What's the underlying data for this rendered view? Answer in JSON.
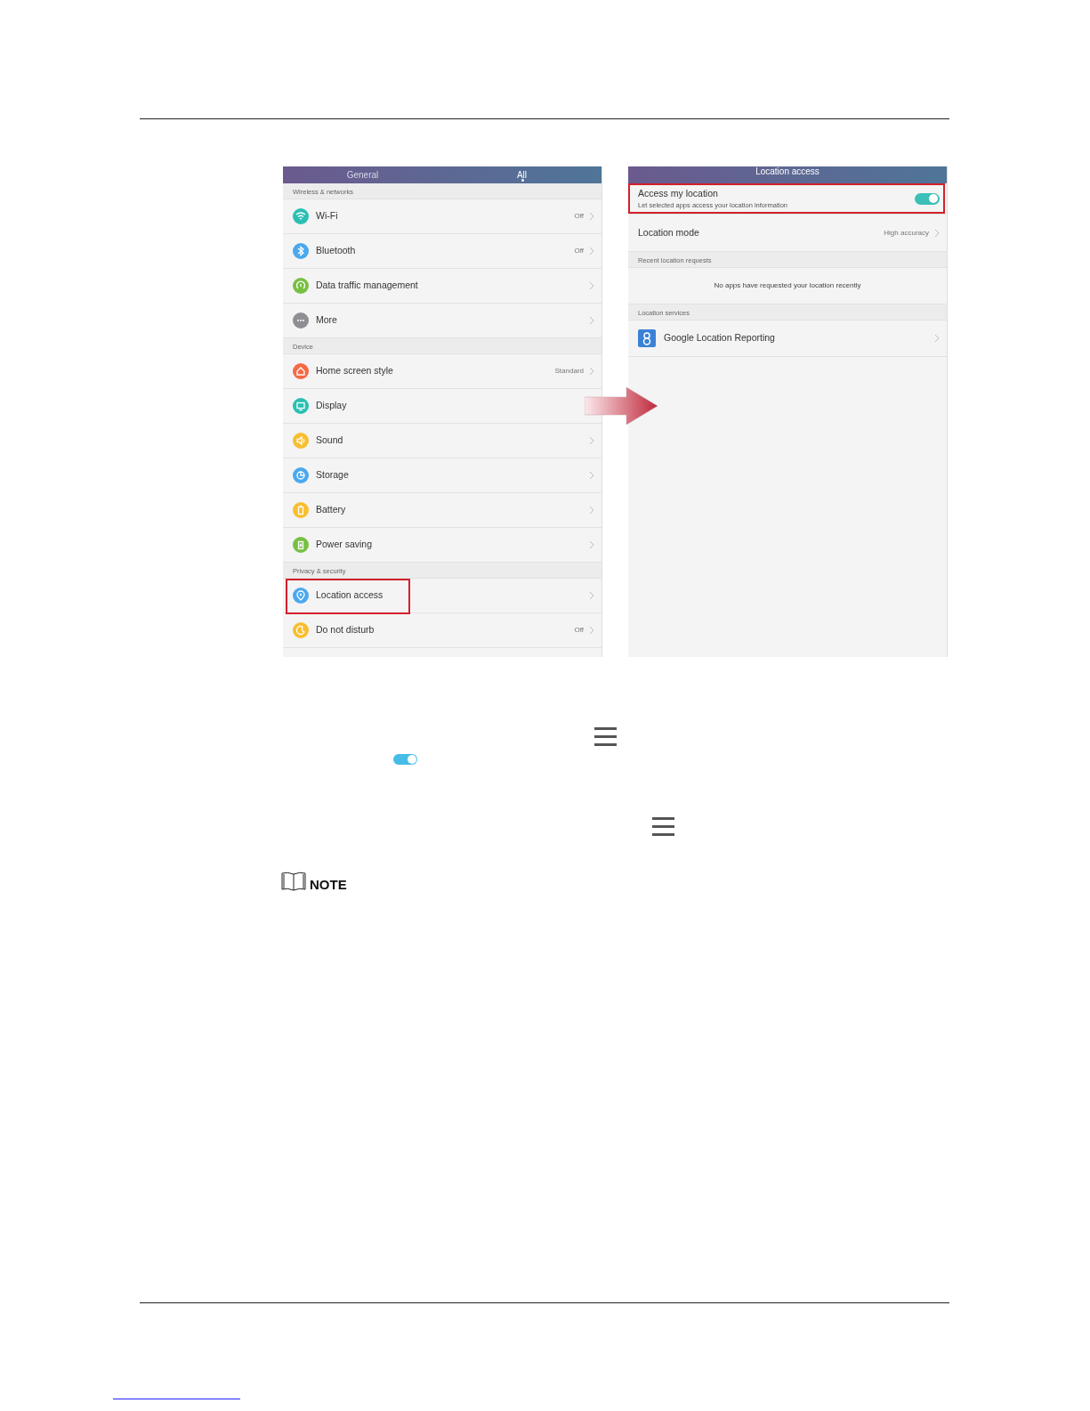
{
  "left_screen": {
    "tabs": [
      {
        "label": "General",
        "selected": false
      },
      {
        "label": "All",
        "selected": true
      }
    ],
    "sections": [
      {
        "title": "Wireless & networks",
        "items": [
          {
            "label": "Wi-Fi",
            "value": "Off",
            "color": "#2bbfb3",
            "highlighted": false
          },
          {
            "label": "Bluetooth",
            "value": "Off",
            "color": "#4aa8ee",
            "highlighted": false
          },
          {
            "label": "Data traffic management",
            "color": "#78c043",
            "highlighted": false
          },
          {
            "label": "More",
            "color": "#8e8e93",
            "highlighted": false
          }
        ]
      },
      {
        "title": "Device",
        "items": [
          {
            "label": "Home screen style",
            "value": "Standard",
            "color": "#f56a45",
            "highlighted": false
          },
          {
            "label": "Display",
            "color": "#2bbfb3",
            "highlighted": false
          },
          {
            "label": "Sound",
            "color": "#f8be2e",
            "highlighted": false
          },
          {
            "label": "Storage",
            "color": "#4aa8ee",
            "highlighted": false
          },
          {
            "label": "Battery",
            "color": "#f8be2e",
            "highlighted": false
          },
          {
            "label": "Power saving",
            "color": "#78c043",
            "highlighted": false
          }
        ]
      },
      {
        "title": "Privacy & security",
        "items": [
          {
            "label": "Location access",
            "color": "#4aa8ee",
            "highlighted": true
          },
          {
            "label": "Do not disturb",
            "value": "Off",
            "color": "#f8be2e",
            "highlighted": false
          }
        ]
      }
    ]
  },
  "right_screen": {
    "title": "Location access",
    "rows": [
      {
        "kind": "toggle",
        "label": "Access my location",
        "description": "Let selected apps access your location information",
        "on": true,
        "highlighted": true
      },
      {
        "kind": "value",
        "label": "Location mode",
        "value": "High accuracy"
      },
      {
        "kind": "header",
        "label": "Recent location requests"
      },
      {
        "kind": "message",
        "label": "No apps have requested your location recently"
      },
      {
        "kind": "header",
        "label": "Location services"
      },
      {
        "kind": "app",
        "label": "Google Location Reporting"
      }
    ]
  },
  "inline_toggle": {
    "on": true
  },
  "note": {
    "label": "NOTE"
  }
}
